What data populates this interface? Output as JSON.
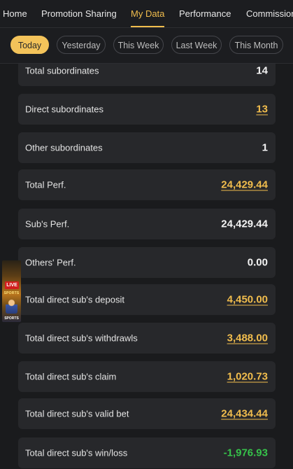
{
  "nav": {
    "tabs": [
      {
        "label": "Home",
        "active": false
      },
      {
        "label": "Promotion Sharing",
        "active": false
      },
      {
        "label": "My Data",
        "active": true
      },
      {
        "label": "Performance",
        "active": false
      },
      {
        "label": "Commission",
        "active": false
      }
    ]
  },
  "filters": {
    "options": [
      {
        "label": "Today",
        "active": true
      },
      {
        "label": "Yesterday",
        "active": false
      },
      {
        "label": "This Week",
        "active": false
      },
      {
        "label": "Last Week",
        "active": false
      },
      {
        "label": "This Month",
        "active": false
      }
    ]
  },
  "stats": [
    {
      "label": "Total subordinates",
      "value": "14",
      "style": "plain"
    },
    {
      "label": "Direct subordinates",
      "value": "13",
      "style": "link"
    },
    {
      "label": "Other subordinates",
      "value": "1",
      "style": "plain"
    },
    {
      "label": "Total Perf.",
      "value": "24,429.44",
      "style": "link"
    },
    {
      "label": "Sub's Perf.",
      "value": "24,429.44",
      "style": "plain"
    },
    {
      "label": "Others' Perf.",
      "value": "0.00",
      "style": "plain"
    },
    {
      "label": "Total direct sub's deposit",
      "value": "4,450.00",
      "style": "link"
    },
    {
      "label": "Total direct sub's withdrawls",
      "value": "3,488.00",
      "style": "link"
    },
    {
      "label": "Total direct sub's claim",
      "value": "1,020.73",
      "style": "link"
    },
    {
      "label": "Total direct sub's valid bet",
      "value": "24,434.44",
      "style": "link"
    },
    {
      "label": "Total direct sub's win/loss",
      "value": "-1,976.93",
      "style": "negative"
    }
  ],
  "banner": {
    "badge": "LIVE",
    "subtitle": "SPORTS",
    "footer": "SPORTS"
  },
  "colors": {
    "accent": "#f1bd4d",
    "negative": "#36c24a",
    "card": "#27282b",
    "background": "#1a1b1d"
  }
}
